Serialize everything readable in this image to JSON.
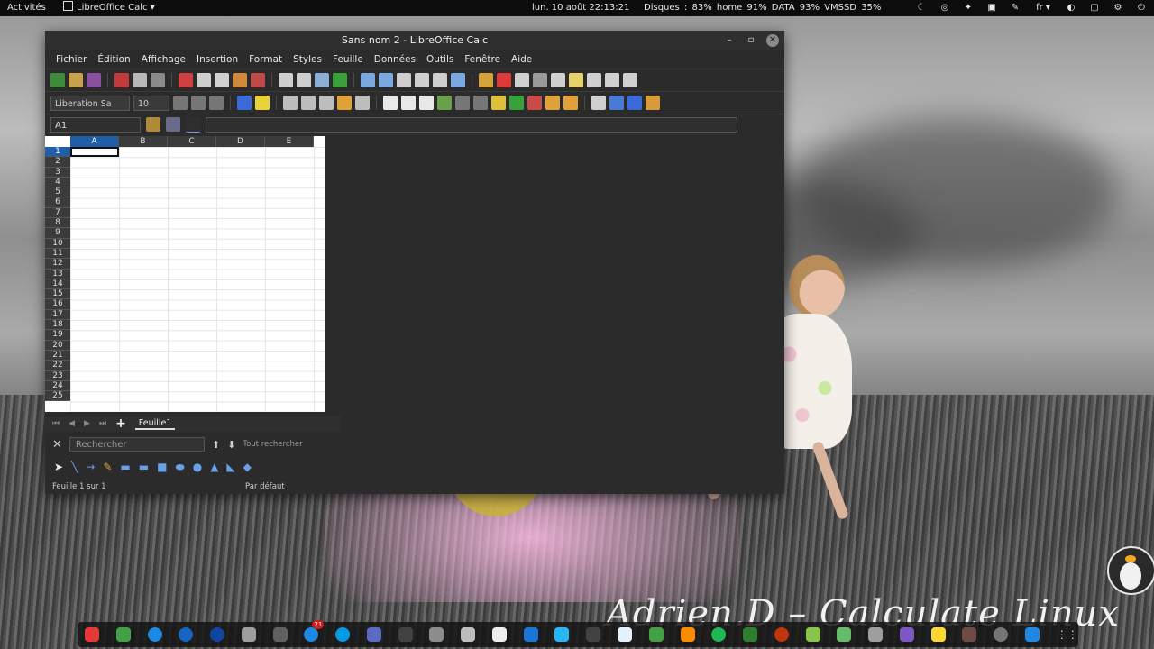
{
  "topbar": {
    "activities": "Activités",
    "app_name": "LibreOffice Calc ▾",
    "clock": "lun. 10 août  22:13:21",
    "stats": "Disques : 83%   home 91%   DATA 93%   VMSSD 35%",
    "lang": "fr ▾"
  },
  "window": {
    "title": "Sans nom 2 - LibreOffice Calc",
    "menu": [
      "Fichier",
      "Édition",
      "Affichage",
      "Insertion",
      "Format",
      "Styles",
      "Feuille",
      "Données",
      "Outils",
      "Fenêtre",
      "Aide"
    ],
    "font_name": "Liberation Sa",
    "font_size": "10",
    "cell_ref": "A1",
    "columns": [
      "A",
      "B",
      "C",
      "D",
      "E"
    ],
    "rows": [
      "1",
      "2",
      "3",
      "4",
      "5",
      "6",
      "7",
      "8",
      "9",
      "10",
      "11",
      "12",
      "13",
      "14",
      "15",
      "16",
      "17",
      "18",
      "19",
      "20",
      "21",
      "22",
      "23",
      "24",
      "25"
    ],
    "sheet_tab": "Feuille1",
    "search_placeholder": "Rechercher",
    "find_all": "Tout rechercher",
    "status_left": "Feuille 1 sur 1",
    "status_right": "Par défaut"
  },
  "wallpaper": {
    "watermark": "Adrien.D – Calculate Linux"
  },
  "dock": {
    "badge": "21",
    "icons": [
      "vivaldi-icon",
      "vim-icon",
      "chromium-icon",
      "edge-icon",
      "thunderbird-icon",
      "mail-icon",
      "app-icon",
      "chat-icon",
      "skype-icon",
      "teams-icon",
      "terminal-icon",
      "files-icon",
      "calc-icon",
      "pdf-icon",
      "xmind-icon",
      "writer-icon",
      "code-icon",
      "docs-icon",
      "sheets-icon",
      "vlc-icon",
      "spotify-icon",
      "folder-icon",
      "record-icon",
      "headphones-icon",
      "android-icon",
      "bird-icon",
      "image-icon",
      "brush-icon",
      "gimp-icon",
      "settings-icon",
      "vscode-icon",
      "app-grid-icon"
    ]
  }
}
